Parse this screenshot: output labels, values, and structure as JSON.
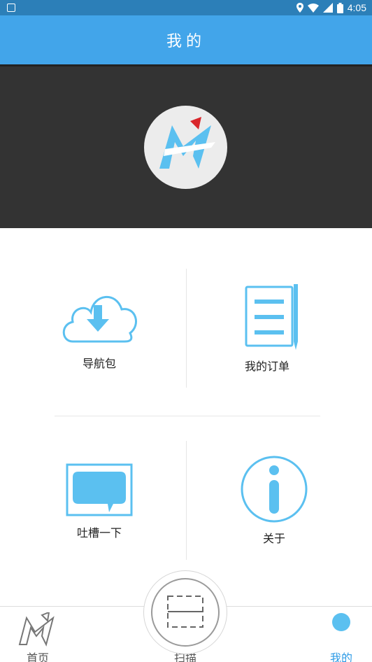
{
  "status_bar": {
    "time": "4:05"
  },
  "title_bar": {
    "title": "我的"
  },
  "menu": {
    "items": [
      {
        "label": "导航包",
        "icon": "cloud-download-icon"
      },
      {
        "label": "我的订单",
        "icon": "order-list-icon"
      },
      {
        "label": "吐槽一下",
        "icon": "chat-bubble-icon"
      },
      {
        "label": "关于",
        "icon": "info-icon"
      }
    ]
  },
  "bottom_nav": {
    "items": [
      {
        "label": "首页",
        "icon": "home-logo-icon"
      },
      {
        "label": "扫描",
        "icon": "scan-icon"
      },
      {
        "label": "我的",
        "icon": "profile-icon"
      }
    ]
  },
  "colors": {
    "accent": "#42a5ea",
    "icon_blue": "#5bc0f0",
    "dark_header": "#333333"
  }
}
